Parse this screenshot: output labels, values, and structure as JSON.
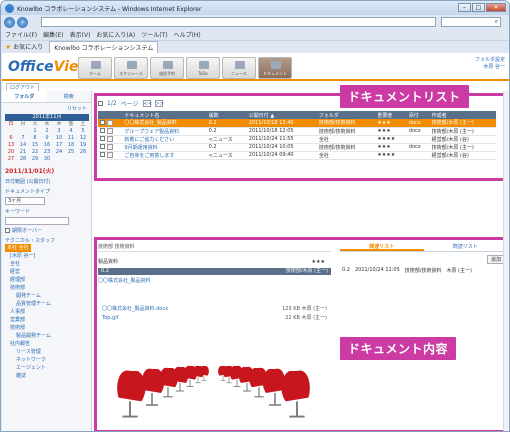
{
  "browser": {
    "title": "Knowlbo コラボレーションシステム - Windows Internet Explorer",
    "menu": [
      "ファイル(F)",
      "編集(E)",
      "表示(V)",
      "お気に入り(A)",
      "ツール(T)",
      "ヘルプ(H)"
    ],
    "favorites_label": "お気に入り",
    "tab_label": "Knowlbo コラボレーションシステム"
  },
  "app": {
    "logo_office": "Office",
    "logo_view": "View",
    "nav": [
      "ホーム",
      "スケジュール",
      "施設予約",
      "ToDo",
      "ニュース",
      "ドキュメント"
    ],
    "user_line1": "フォルダ設定",
    "user_line2": "木原 谷一",
    "logout": "ログアウト"
  },
  "sidebar": {
    "tabs": [
      "フォルダ",
      "検索"
    ],
    "reset": "リセット",
    "calendar_title": "2011年11月",
    "weekdays": [
      "日",
      "月",
      "火",
      "水",
      "木",
      "金",
      "土"
    ],
    "days": [
      "",
      "",
      "1",
      "2",
      "3",
      "4",
      "5",
      "6",
      "7",
      "8",
      "9",
      "10",
      "11",
      "12",
      "13",
      "14",
      "15",
      "16",
      "17",
      "18",
      "19",
      "20",
      "21",
      "22",
      "23",
      "24",
      "25",
      "26",
      "27",
      "28",
      "29",
      "30",
      "",
      "",
      ""
    ],
    "date": "2011/11/01(火)",
    "date_range_label": "日付範囲 (公開日付)",
    "doc_type_label": "ドキュメントタイプ",
    "doc_type_value": "3ヶ月",
    "keyword_label": "キーワード",
    "expired_label": "期限オーバー",
    "tech_label": "テクニカル・スタッフ",
    "tree": [
      "本社 全社",
      "[木原 谷一]",
      "全社",
      "経営",
      "経理部",
      "技術部",
      "開発チーム",
      "品質管理チーム",
      "人事部",
      "営業部",
      "技術部",
      "製品開発チーム",
      "社内報告",
      "リース管理",
      "ネットワーク",
      "エージェント",
      "雑誌"
    ]
  },
  "doc_list": {
    "label": "ドキュメントリスト",
    "pager_text": "1/2",
    "pager_page": "ページ",
    "pager_prev": "<<",
    "pager_next": ">>",
    "headers": [
      "",
      "ドキュメント名",
      "版数",
      "公開日付 ▲",
      "フォルダ",
      "重要度",
      "添付",
      "作成者"
    ],
    "rows": [
      {
        "name": "〇〇株式会社_製品資料",
        "ver": "0.2",
        "date": "2011/10/18 13:40",
        "folder": "技術部/技術資料",
        "imp": "★★★",
        "att": "docx",
        "owner": "技術部/木原 (主一)",
        "hl": true
      },
      {
        "name": "グループウェア製品資料",
        "ver": "0.2",
        "date": "2011/10/18 12:05",
        "folder": "技術部/技術資料",
        "imp": "★★★",
        "att": "docx",
        "owner": "技術部/木原 (主一)",
        "hl": false
      },
      {
        "name": "新着にご協力ください",
        "ver": "<ニュース",
        "date": "2011/10/24 11:55",
        "folder": "全社",
        "imp": "★★★★",
        "att": "",
        "owner": "経営部/木原 (谷)",
        "hl": false
      },
      {
        "name": "9月期運用資料",
        "ver": "0.2",
        "date": "2011/10/24 10:05",
        "folder": "技術部/技術資料",
        "imp": "★★★",
        "att": "docx",
        "owner": "技術部/木原 (主一)",
        "hl": false
      },
      {
        "name": "ご自身をご用意します",
        "ver": "<ニュース",
        "date": "2011/10/24 09:40",
        "folder": "全社",
        "imp": "★★★★",
        "att": "",
        "owner": "経営部/木原 (谷)",
        "hl": false
      }
    ]
  },
  "doc_detail": {
    "label": "ドキュメント内容",
    "header": "技術部 技術資料",
    "title": "製品資料",
    "stars": "★★★",
    "bar_left": "0.2",
    "bar_right": "技術部/木原 (主一)",
    "link": "〇〇株式会社_製品資料",
    "files": [
      {
        "name": "〇〇株式会社_製品資料.docx",
        "size": "123 KB",
        "owner": "木原 (主一)"
      },
      {
        "name": "Top.gif",
        "size": "22 KB",
        "owner": "木原 (主一)"
      }
    ]
  },
  "related": {
    "tabs": [
      "関連リスト",
      "既読リスト"
    ],
    "add_label": "追加",
    "row_ver": "0.2",
    "row_date": "2011/10/24 11:05",
    "row_folder": "技術部/技術資料",
    "row_owner": "木原 (主一)"
  }
}
